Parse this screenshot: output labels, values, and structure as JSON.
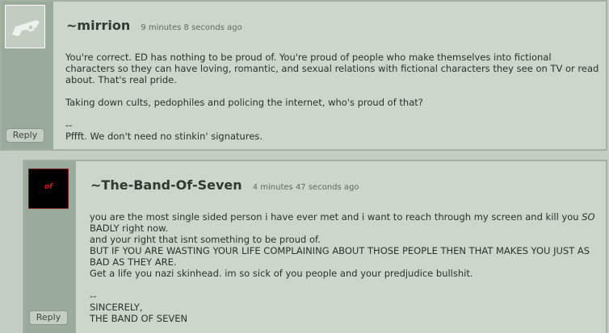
{
  "comments": [
    {
      "username": "~mirrion",
      "timestamp": "9 minutes 8 seconds ago",
      "reply_label": "Reply",
      "avatar_icon": "deviantart-logo-icon",
      "lines": [
        "You're correct. ED has nothing to be proud of. You're proud of people who make themselves into fictional characters so they can have loving, romantic, and sexual relations with fictional characters they see on TV or read about. That's real pride.",
        "Taking down cults, pedophiles and policing the internet, who's proud of that?",
        "--",
        "Pffft. We don't need no stinkin' signatures."
      ]
    },
    {
      "username": "~The-Band-Of-Seven",
      "timestamp": "4 minutes 47 seconds ago",
      "reply_label": "Reply",
      "avatar_label": "of",
      "line1_pre": "you are the most single sided person i have ever met and i want to reach through my screen and kill you ",
      "line1_em": "SO",
      "line1_post": " BADLY right now.",
      "line2": "and your right that isnt something to be proud of.",
      "line3": "BUT IF YOU ARE WASTING YOUR LIFE COMPLAINING ABOUT THOSE PEOPLE THEN THAT MAKES YOU JUST AS BAD AS THEY ARE.",
      "line4": "Get a life you nazi skinhead. im so sick of you people and your predjudice bullshit.",
      "sig_dash": "--",
      "sig1": "SINCERELY,",
      "sig2": "THE BAND OF SEVEN"
    }
  ]
}
